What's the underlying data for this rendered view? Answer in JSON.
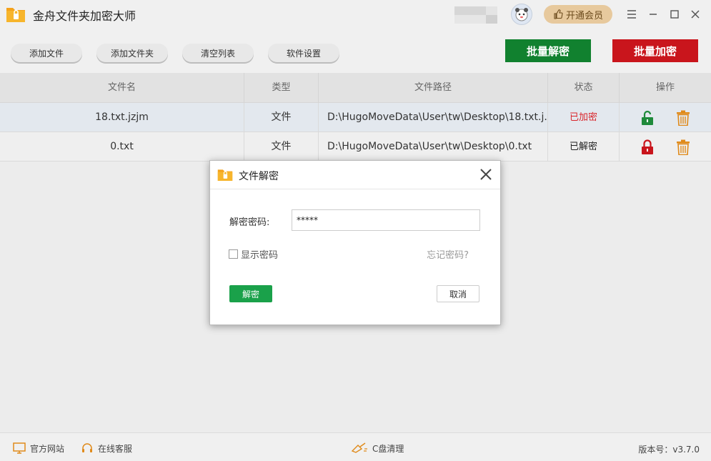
{
  "app": {
    "title": "金舟文件夹加密大师",
    "vip_label": "开通会员",
    "colors": {
      "green": "#11812f",
      "red": "#c9151c",
      "vip": "#e7c99d"
    }
  },
  "toolbar": {
    "add_file": "添加文件",
    "add_folder": "添加文件夹",
    "clear_list": "清空列表",
    "settings": "软件设置",
    "batch_decrypt": "批量解密",
    "batch_encrypt": "批量加密"
  },
  "table": {
    "headers": [
      "文件名",
      "类型",
      "文件路径",
      "状态",
      "操作"
    ],
    "rows": [
      {
        "name": "18.txt.jzjm",
        "type": "文件",
        "path": "D:\\HugoMoveData\\User\\tw\\Desktop\\18.txt.j...",
        "status": "已加密",
        "lock_icon": "unlock-icon"
      },
      {
        "name": "0.txt",
        "type": "文件",
        "path": "D:\\HugoMoveData\\User\\tw\\Desktop\\0.txt",
        "status": "已解密",
        "lock_icon": "lock-icon"
      }
    ]
  },
  "dialog": {
    "title": "文件解密",
    "password_label": "解密密码:",
    "password_value": "*****",
    "show_password": "显示密码",
    "forgot_password": "忘记密码?",
    "decrypt_button": "解密",
    "cancel_button": "取消"
  },
  "footer": {
    "website": "官方网站",
    "support": "在线客服",
    "c_clean": "C盘清理",
    "version": "版本号：v3.7.0"
  }
}
